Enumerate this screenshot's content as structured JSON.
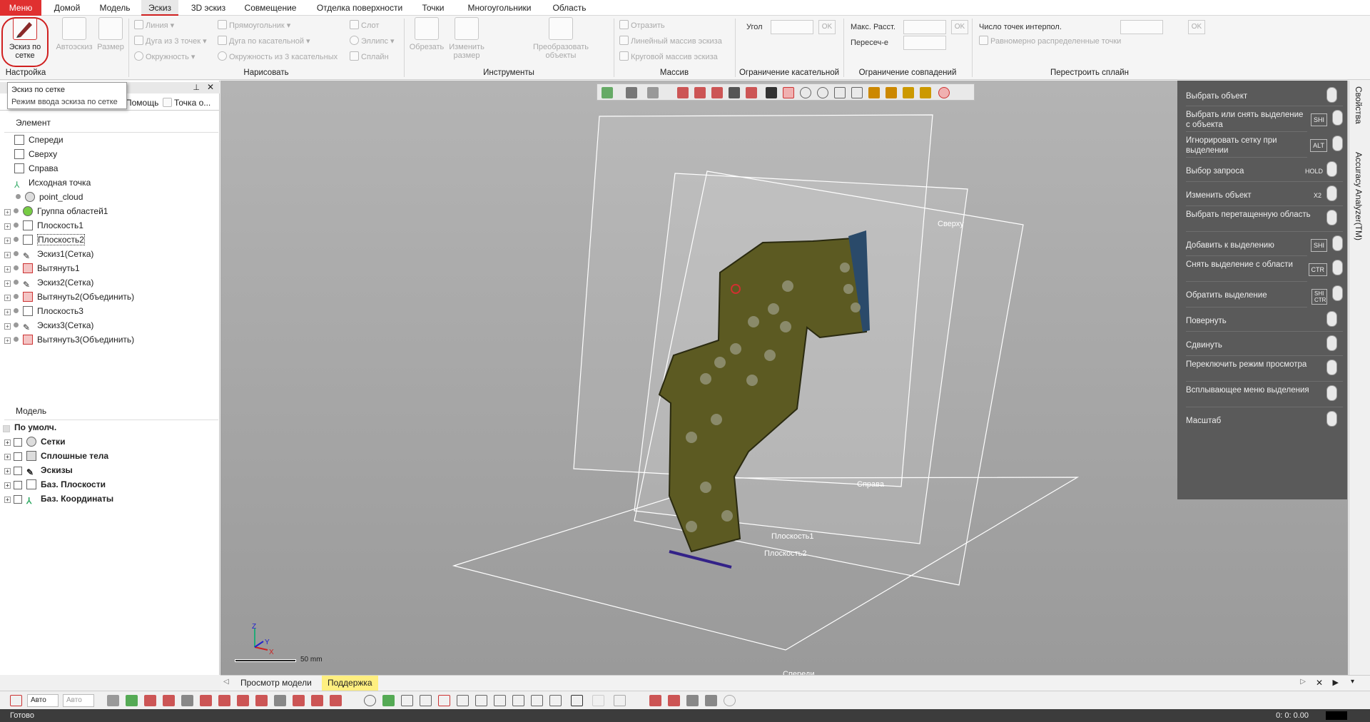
{
  "menubar": {
    "menu": "Меню",
    "tabs": [
      "Домой",
      "Модель",
      "Эскиз",
      "3D эскиз",
      "Совмещение",
      "Отделка поверхности",
      "Точки",
      "Многоугольники",
      "Область"
    ],
    "active_tab": "Эскиз"
  },
  "ribbon": {
    "groups": {
      "nastroyka": "Настройка",
      "narisovat": "Нарисовать",
      "instrumenty": "Инструменты",
      "massiv": "Массив",
      "ogr_kas": "Ограничение касательной",
      "ogr_sovp": "Ограничение совпадений",
      "perestroit": "Перестроить сплайн"
    },
    "sketch_grid": "Эскиз по сетке",
    "autosketch": "Автоэскиз",
    "size": "Размер",
    "draw": {
      "line": "Линия",
      "arc3": "Дуга из 3 точек",
      "circle": "Окружность",
      "rect": "Прямоугольник",
      "arc_tan": "Дуга по касательной",
      "circle3": "Окружность из 3 касательных",
      "slot": "Слот",
      "ellipse": "Эллипс",
      "spline": "Сплайн"
    },
    "tools": {
      "trim": "Обрезать",
      "resize": "Изменить размер",
      "transform": "Преобразовать объекты"
    },
    "array": {
      "mirror": "Отразить",
      "linear": "Линейный массив эскиза",
      "circular": "Круговой массив эскиза"
    },
    "tangent": {
      "angle": "Угол"
    },
    "coincident": {
      "max_dist": "Макс. Расст.",
      "intersect": "Пересеч-е"
    },
    "spline": {
      "interp_points": "Число точек интерпол.",
      "uniform": "Равномерно распределенные точки"
    },
    "ok": "OK"
  },
  "tooltip": {
    "title": "Эскиз по сетке",
    "desc": "Режим ввода эскиза по сетке"
  },
  "leftpanel": {
    "tabs": [
      "Помощь",
      "Точка о..."
    ],
    "header_element": "Элемент",
    "tree": [
      "Спереди",
      "Сверху",
      "Справа",
      "Исходная точка",
      "point_cloud",
      "Группа областей1",
      "Плоскость1",
      "Плоскость2",
      "Эскиз1(Сетка)",
      "Вытянуть1",
      "Эскиз2(Сетка)",
      "Вытянуть2(Объединить)",
      "Плоскость3",
      "Эскиз3(Сетка)",
      "Вытянуть3(Объединить)"
    ],
    "header_model": "Модель",
    "model_tree": [
      "По умолч.",
      "Сетки",
      "Сплошные тела",
      "Эскизы",
      "Баз. Плоскости",
      "Баз. Координаты"
    ]
  },
  "viewport": {
    "labels": {
      "top": "Сверху",
      "right": "Справа",
      "plane1": "Плоскость1",
      "plane2": "Плоскость2",
      "front": "Спереди"
    },
    "scale": "50 mm",
    "axes": {
      "z": "Z",
      "y": "Y",
      "x": "X"
    }
  },
  "rightpanel": {
    "items": [
      {
        "label": "Выбрать объект",
        "key": ""
      },
      {
        "label": "Выбрать или снять выделение с объекта",
        "key": "SHI"
      },
      {
        "label": "Игнорировать сетку при выделении",
        "key": "ALT"
      },
      {
        "label": "Выбор запроса",
        "key": "HOLD"
      },
      {
        "label": "Изменить объект",
        "key": "X2"
      },
      {
        "label": "Выбрать перетащенную область",
        "key": ""
      },
      {
        "label": "Добавить к выделению",
        "key": "SHI"
      },
      {
        "label": "Снять выделение с области",
        "key": "CTR"
      },
      {
        "label": "Обратить выделение",
        "key": "SHI CTR"
      },
      {
        "label": "Повернуть",
        "key": ""
      },
      {
        "label": "Сдвинуть",
        "key": ""
      },
      {
        "label": "Переключить режим просмотра",
        "key": ""
      },
      {
        "label": "Всплывающее меню выделения",
        "key": ""
      },
      {
        "label": "Масштаб",
        "key": ""
      }
    ]
  },
  "sidetabs": [
    "Свойства",
    "Accuracy Analyzer(TM)"
  ],
  "bottabs": {
    "view": "Просмотр модели",
    "support": "Поддержка"
  },
  "bottoolbar": {
    "auto1": "Авто",
    "auto2": "Авто"
  },
  "status": {
    "left": "Готово",
    "right": "0: 0: 0.00"
  },
  "colors": {
    "menu_red": "#e03030",
    "part_olive": "#5c5a22",
    "panel_dark": "#5a5a5a"
  }
}
